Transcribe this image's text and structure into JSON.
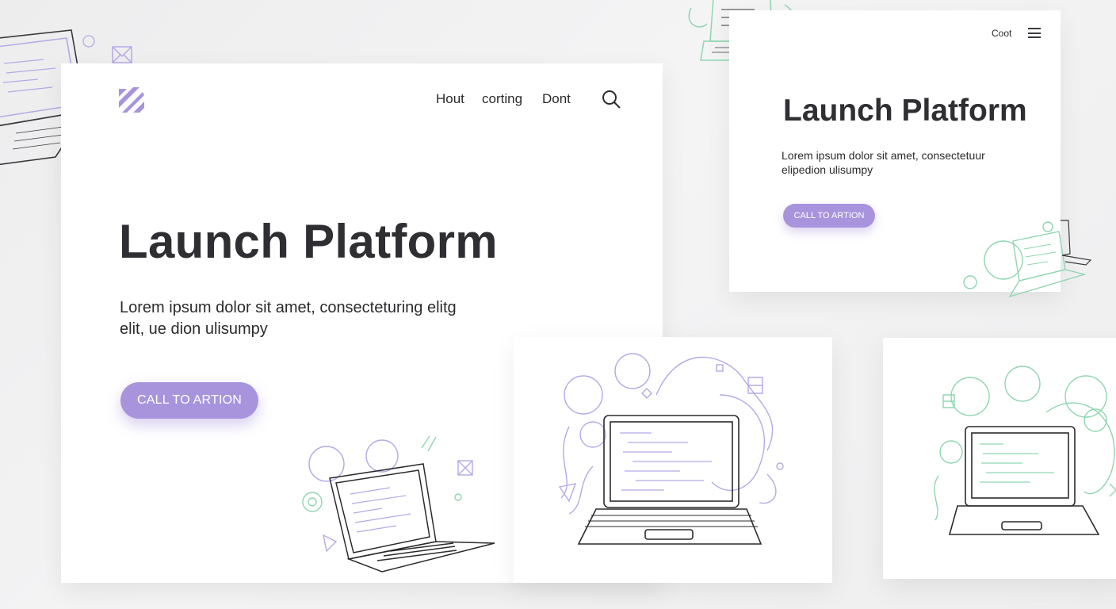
{
  "main": {
    "nav": [
      "Hout",
      "corting",
      "Dont"
    ],
    "title": "Launch Platform",
    "description_line1": "Lorem ipsum dolor sit amet, consecteturing elitg",
    "description_line2": "elit, ue dion ulisumpy",
    "cta_label": "CALL TO ARTION"
  },
  "mobile": {
    "nav_link": "Coot",
    "title": "Launch Platform",
    "description_line1": "Lorem ipsum dolor sit amet, consectetuur",
    "description_line2": "elipedion ulisumpy",
    "cta_label": "CALL TO ARTION"
  },
  "colors": {
    "accent": "#a894dd",
    "accent_green": "#8fd6b0",
    "text": "#2b2b2e",
    "background": "#f0f0f1"
  },
  "icons": [
    "logo-icon",
    "search-icon",
    "menu-icon",
    "laptop-illustration"
  ]
}
